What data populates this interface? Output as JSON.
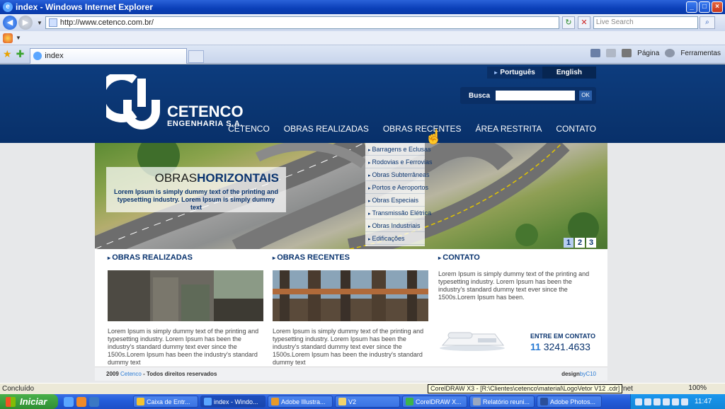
{
  "window": {
    "title": "index - Windows Internet Explorer"
  },
  "browser": {
    "url": "http://www.cetenco.com.br/",
    "search_placeholder": "Live Search",
    "tab_label": "index",
    "commands": {
      "page": "Página",
      "tools": "Ferramentas"
    }
  },
  "site": {
    "languages": [
      "Português",
      "English"
    ],
    "search_label": "Busca",
    "search_button": "OK",
    "logo": {
      "name": "CETENCO",
      "subtitle": "ENGENHARIA S.A."
    },
    "nav": [
      "CETENCO",
      "OBRAS REALIZADAS",
      "OBRAS RECENTES",
      "ÁREA RESTRITA",
      "CONTATO"
    ],
    "dropdown": [
      "Barragens e Eclusas",
      "Rodovias e Ferrovias",
      "Obras Subterrâneas",
      "Portos e Aeroportos",
      "Obras Especiais",
      "Transmissão Elétrica",
      "Obras Industriais",
      "Edificações"
    ],
    "hero": {
      "title_a": "OBRAS",
      "title_b": "HORIZONTAIS",
      "text": "Lorem Ipsum is simply dummy text of the printing and typesetting industry. Lorem Ipsum is simply dummy text"
    },
    "slides": [
      "1",
      "2",
      "3"
    ],
    "sections": {
      "realizadas": {
        "title": "OBRAS REALIZADAS",
        "text": "Lorem Ipsum is simply dummy text of the printing and typesetting industry. Lorem Ipsum has been the industry's standard dummy text ever since the 1500s.Lorem Ipsum has been the industry's standard dummy text"
      },
      "recentes": {
        "title": "OBRAS RECENTES",
        "text": "Lorem Ipsum is simply dummy text of the printing and typesetting industry. Lorem Ipsum has been the industry's standard dummy text ever since the 1500s.Lorem Ipsum has been the industry's standard dummy text"
      },
      "contato": {
        "title": "CONTATO",
        "text": "Lorem Ipsum is simply dummy text of the printing and typesetting industry. Lorem Ipsum has been the industry's standard dummy text ever since the 1500s.Lorem Ipsum has been.",
        "entre": "ENTRE EM CONTATO",
        "area_code": "11",
        "phone": "3241.4633"
      }
    },
    "footer": {
      "year": "2009",
      "brand": "Cetenco",
      "rights": "- Todos direitos reservados",
      "design": "design",
      "by": "byC10"
    }
  },
  "status": {
    "text": "Concluído",
    "tooltip": "CorelDRAW X3 - [R:\\Clientes\\cetenco\\material\\LogoVetor V12 .cdr]",
    "zone": "Internet",
    "zoom": "100%"
  },
  "taskbar": {
    "start": "Iniciar",
    "tasks": [
      "Caixa de Entr...",
      "index - Windo...",
      "Adobe Illustra...",
      "V2",
      "CorelDRAW X...",
      "Relatório reuni...",
      "Adobe Photos..."
    ],
    "clock": "11:47"
  }
}
